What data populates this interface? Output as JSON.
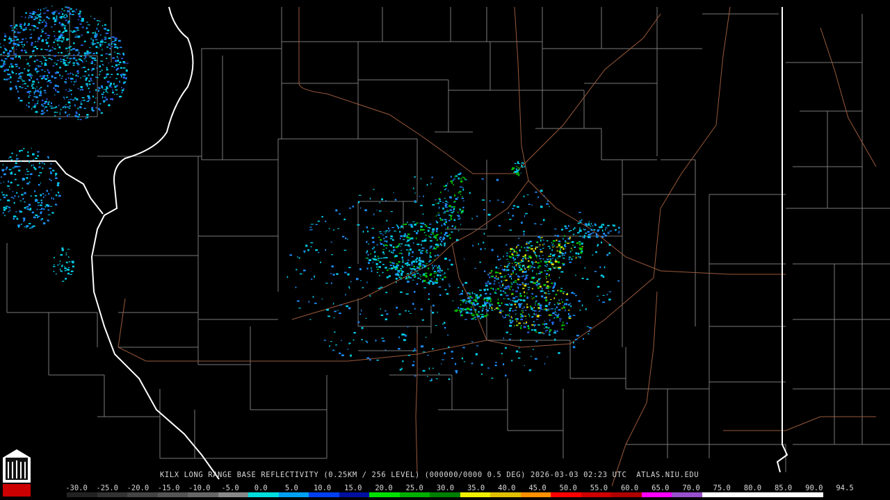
{
  "caption": "KILX LONG RANGE BASE REFLECTIVITY (0.25KM / 256 LEVEL) (000000/0000 0.5 DEG) 2026-03-03 02:23 UTC  ATLAS.NIU.EDU",
  "logo_text": "NIU",
  "scale": {
    "labels": [
      "-30.0",
      "-25.0",
      "-20.0",
      "-15.0",
      "-10.0",
      "-5.0",
      "0.0",
      "5.0",
      "10.0",
      "15.0",
      "20.0",
      "25.0",
      "30.0",
      "35.0",
      "40.0",
      "45.0",
      "50.0",
      "55.0",
      "60.0",
      "65.0",
      "70.0",
      "75.0",
      "80.0",
      "85.0",
      "90.0",
      "94.5"
    ],
    "colors": [
      "#222222",
      "#333333",
      "#444444",
      "#555555",
      "#666666",
      "#888888",
      "#00dddd",
      "#00a0f0",
      "#0040f0",
      "#0010a0",
      "#00e000",
      "#00b000",
      "#008000",
      "#f0f000",
      "#e0c000",
      "#ff9000",
      "#ff0000",
      "#d00000",
      "#b00000",
      "#ff00ff",
      "#9950cc",
      "#ffffff",
      "#ffffff",
      "#ffffff",
      "#ffffff"
    ]
  },
  "map": {
    "state_border_color": "#ffffff",
    "county_line_color": "#7a7a7a",
    "highway_color": "#9a5a3a",
    "echo_colors": [
      "#00cfe8",
      "#1e90ff",
      "#2a5fe8",
      "#00c000",
      "#e0e000"
    ]
  }
}
